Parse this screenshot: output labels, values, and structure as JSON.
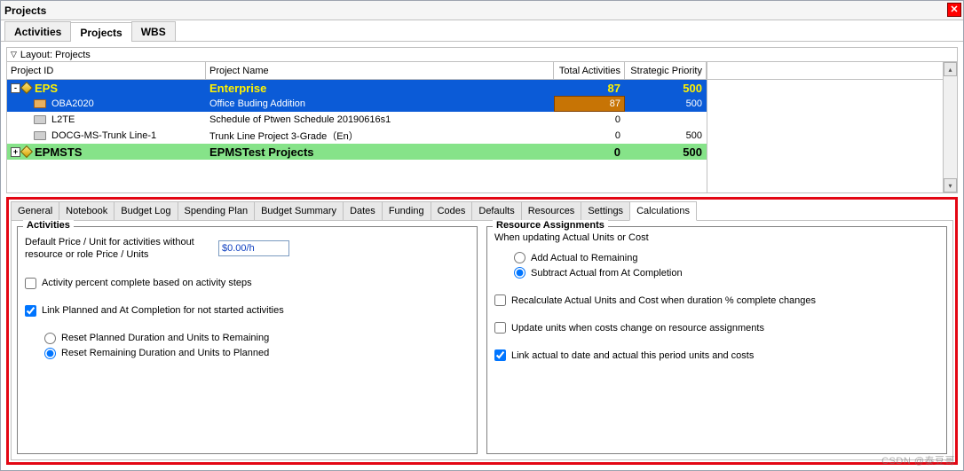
{
  "window_title": "Projects",
  "main_tabs": [
    "Activities",
    "Projects",
    "WBS"
  ],
  "main_tab_active": 1,
  "layout_label": "Layout: Projects",
  "columns": {
    "pid": "Project ID",
    "pname": "Project Name",
    "ta": "Total Activities",
    "sp": "Strategic Priority"
  },
  "rows": [
    {
      "kind": "eps-root",
      "exp": "-",
      "pid": "EPS",
      "pname": "Enterprise",
      "ta": "87",
      "sp": "500"
    },
    {
      "kind": "selected",
      "pid": "OBA2020",
      "pname": "Office Buding Addition",
      "ta": "87",
      "sp": "500"
    },
    {
      "kind": "plain",
      "pid": "L2TE",
      "pname": "Schedule of Ptwen Schedule 20190616s1",
      "ta": "0",
      "sp": ""
    },
    {
      "kind": "plain",
      "pid": "DOCG-MS-Trunk Line-1",
      "pname": "Trunk Line Project 3-Grade（En）",
      "ta": "0",
      "sp": "500"
    },
    {
      "kind": "green",
      "exp": "+",
      "pid": "EPMSTS",
      "pname": "EPMSTest Projects",
      "ta": "0",
      "sp": "500"
    }
  ],
  "detail_tabs": [
    "General",
    "Notebook",
    "Budget Log",
    "Spending Plan",
    "Budget Summary",
    "Dates",
    "Funding",
    "Codes",
    "Defaults",
    "Resources",
    "Settings",
    "Calculations"
  ],
  "detail_tab_active": 11,
  "activities": {
    "legend": "Activities",
    "price_label": "Default Price / Unit for activities without resource or role Price / Units",
    "price_value": "$0.00/h",
    "chk_steps": "Activity percent complete based on activity steps",
    "chk_steps_checked": false,
    "chk_link_plan": "Link Planned and At Completion for not started activities",
    "chk_link_plan_checked": true,
    "rdo1": "Reset Planned Duration and Units to Remaining",
    "rdo2": "Reset Remaining Duration and Units to Planned",
    "rdo_selected": 2
  },
  "resources": {
    "legend": "Resource Assignments",
    "when_label": "When updating Actual Units or Cost",
    "rdo_add": "Add Actual to Remaining",
    "rdo_sub": "Subtract Actual from At Completion",
    "rdo_selected": 2,
    "chk_recalc": "Recalculate Actual Units and Cost when duration % complete changes",
    "chk_recalc_checked": false,
    "chk_update_units": "Update units when costs change on resource assignments",
    "chk_update_units_checked": false,
    "chk_link_actual": "Link actual to date and actual this period units and costs",
    "chk_link_actual_checked": true
  },
  "watermark": "CSDN @泰豆哥"
}
